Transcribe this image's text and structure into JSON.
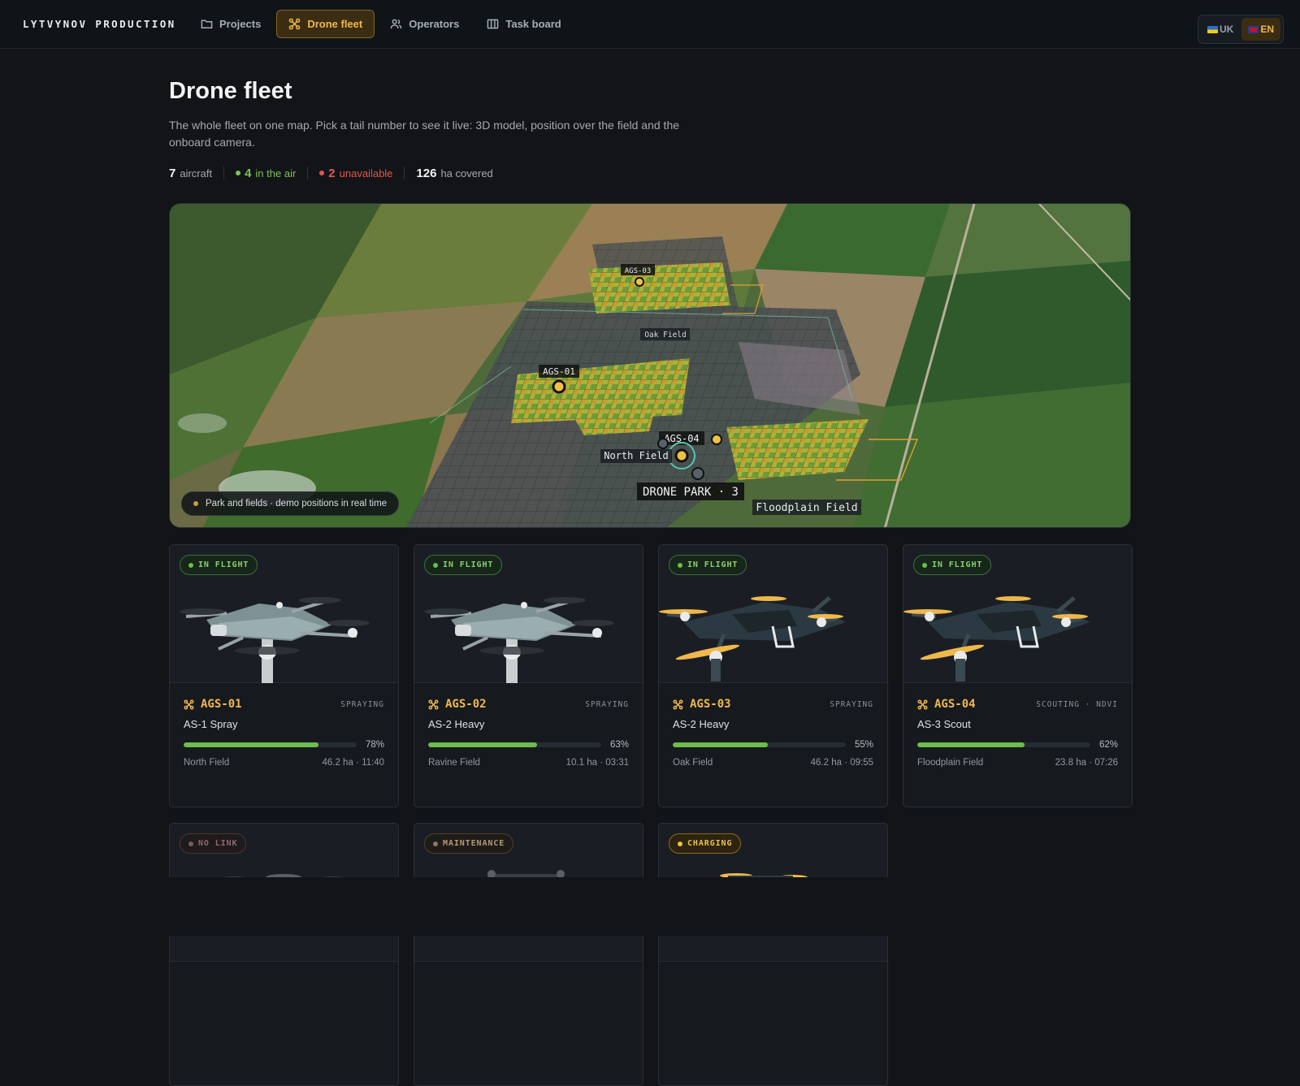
{
  "brand": "LYTVYNOV PRODUCTION",
  "nav": {
    "projects": "Projects",
    "drone_fleet": "Drone fleet",
    "operators": "Operators",
    "task_board": "Task board",
    "active": "drone_fleet"
  },
  "lang": {
    "uk": "UK",
    "en": "EN",
    "active": "EN"
  },
  "page": {
    "title": "Drone fleet",
    "description": "The whole fleet on one map. Pick a tail number to see it live: 3D model, position over the field and the onboard camera."
  },
  "stats": {
    "aircraft_count": "7",
    "aircraft_label": "aircraft",
    "in_air_count": "4",
    "in_air_label": "in the air",
    "unavailable_count": "2",
    "unavailable_label": "unavailable",
    "covered_count": "126",
    "covered_label": "ha covered"
  },
  "map": {
    "labels": {
      "ags03": "AGS-03",
      "ags01": "AGS-01",
      "ags04": "AGS-04",
      "oak_field": "Oak Field",
      "north_field": "North Field",
      "drone_park": "DRONE PARK · 3",
      "floodplain_field": "Floodplain Field"
    },
    "caption": "Park and fields · demo positions in real time"
  },
  "colors": {
    "accent": "#f0b84a",
    "in_flight": "#7cc35a",
    "unavailable": "#e5544b",
    "progress": "#6cbd4c"
  },
  "drones": [
    {
      "status": "IN FLIGHT",
      "tail": "AGS-01",
      "task": "SPRAYING",
      "model": "AS-1 Spray",
      "progress": 78,
      "progress_label": "78%",
      "field": "North Field",
      "meta": "46.2 ha · 11:40",
      "type": "light"
    },
    {
      "status": "IN FLIGHT",
      "tail": "AGS-02",
      "task": "SPRAYING",
      "model": "AS-2 Heavy",
      "progress": 63,
      "progress_label": "63%",
      "field": "Ravine Field",
      "meta": "10.1 ha · 03:31",
      "type": "light"
    },
    {
      "status": "IN FLIGHT",
      "tail": "AGS-03",
      "task": "SPRAYING",
      "model": "AS-2 Heavy",
      "progress": 55,
      "progress_label": "55%",
      "field": "Oak Field",
      "meta": "46.2 ha · 09:55",
      "type": "dark"
    },
    {
      "status": "IN FLIGHT",
      "tail": "AGS-04",
      "task": "SCOUTING · NDVI",
      "model": "AS-3 Scout",
      "progress": 62,
      "progress_label": "62%",
      "field": "Floodplain Field",
      "meta": "23.8 ha · 07:26",
      "type": "dark"
    },
    {
      "status": "NO LINK",
      "status_kind": "nolink"
    },
    {
      "status": "MAINTENANCE",
      "status_kind": "maint"
    },
    {
      "status": "CHARGING",
      "status_kind": "charge"
    }
  ]
}
